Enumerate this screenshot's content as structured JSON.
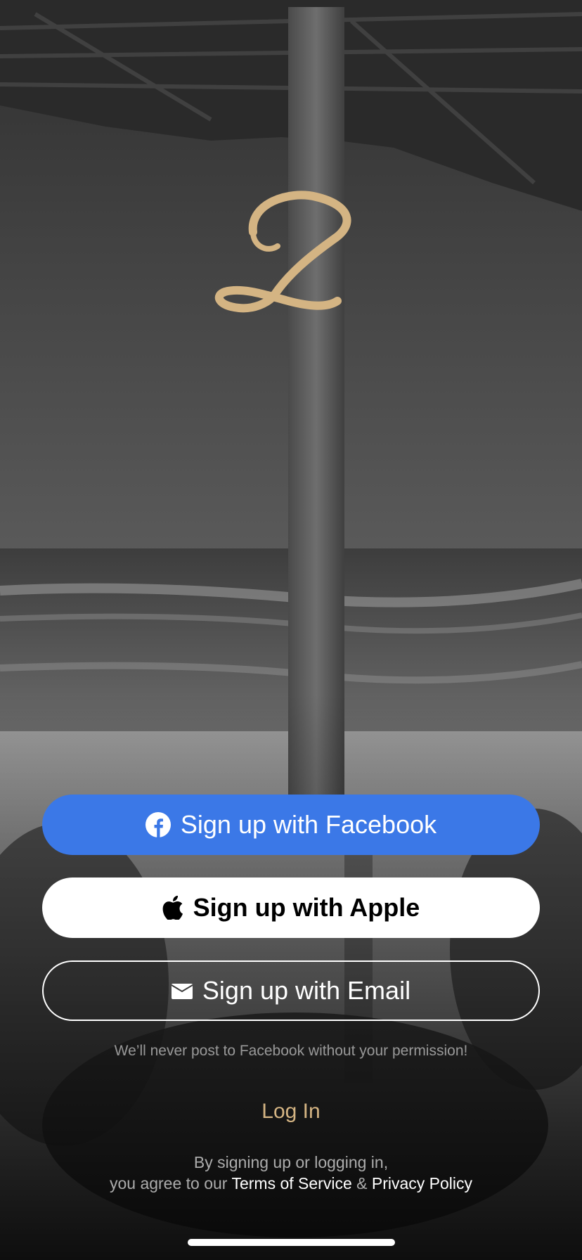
{
  "background": {
    "description_icon": "beach-photo-background"
  },
  "brand": {
    "logo_icon": "script-l-logo-icon",
    "logo_color": "#d4b483"
  },
  "buttons": {
    "facebook": {
      "label": "Sign up with Facebook",
      "icon": "facebook-icon",
      "color": "#3b78e7"
    },
    "apple": {
      "label": "Sign up with Apple",
      "icon": "apple-icon",
      "color": "#ffffff"
    },
    "email": {
      "label": "Sign up with Email",
      "icon": "envelope-icon"
    }
  },
  "disclaimer": "We’ll never post to Facebook without your permission!",
  "login_label": "Log In",
  "legal": {
    "line1": "By signing up or logging in,",
    "line2_prefix": "you agree to our",
    "terms": "Terms of Service",
    "ampersand": "&",
    "privacy": "Privacy Policy"
  }
}
